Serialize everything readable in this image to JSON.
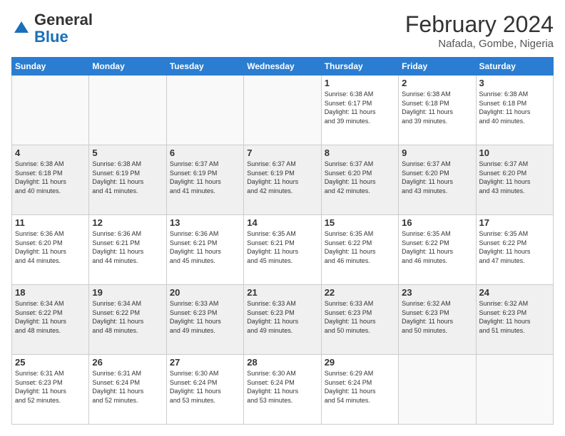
{
  "header": {
    "logo_general": "General",
    "logo_blue": "Blue",
    "title": "February 2024",
    "subtitle": "Nafada, Gombe, Nigeria"
  },
  "days_of_week": [
    "Sunday",
    "Monday",
    "Tuesday",
    "Wednesday",
    "Thursday",
    "Friday",
    "Saturday"
  ],
  "weeks": [
    [
      {
        "num": "",
        "info": ""
      },
      {
        "num": "",
        "info": ""
      },
      {
        "num": "",
        "info": ""
      },
      {
        "num": "",
        "info": ""
      },
      {
        "num": "1",
        "info": "Sunrise: 6:38 AM\nSunset: 6:17 PM\nDaylight: 11 hours\nand 39 minutes."
      },
      {
        "num": "2",
        "info": "Sunrise: 6:38 AM\nSunset: 6:18 PM\nDaylight: 11 hours\nand 39 minutes."
      },
      {
        "num": "3",
        "info": "Sunrise: 6:38 AM\nSunset: 6:18 PM\nDaylight: 11 hours\nand 40 minutes."
      }
    ],
    [
      {
        "num": "4",
        "info": "Sunrise: 6:38 AM\nSunset: 6:18 PM\nDaylight: 11 hours\nand 40 minutes."
      },
      {
        "num": "5",
        "info": "Sunrise: 6:38 AM\nSunset: 6:19 PM\nDaylight: 11 hours\nand 41 minutes."
      },
      {
        "num": "6",
        "info": "Sunrise: 6:37 AM\nSunset: 6:19 PM\nDaylight: 11 hours\nand 41 minutes."
      },
      {
        "num": "7",
        "info": "Sunrise: 6:37 AM\nSunset: 6:19 PM\nDaylight: 11 hours\nand 42 minutes."
      },
      {
        "num": "8",
        "info": "Sunrise: 6:37 AM\nSunset: 6:20 PM\nDaylight: 11 hours\nand 42 minutes."
      },
      {
        "num": "9",
        "info": "Sunrise: 6:37 AM\nSunset: 6:20 PM\nDaylight: 11 hours\nand 43 minutes."
      },
      {
        "num": "10",
        "info": "Sunrise: 6:37 AM\nSunset: 6:20 PM\nDaylight: 11 hours\nand 43 minutes."
      }
    ],
    [
      {
        "num": "11",
        "info": "Sunrise: 6:36 AM\nSunset: 6:20 PM\nDaylight: 11 hours\nand 44 minutes."
      },
      {
        "num": "12",
        "info": "Sunrise: 6:36 AM\nSunset: 6:21 PM\nDaylight: 11 hours\nand 44 minutes."
      },
      {
        "num": "13",
        "info": "Sunrise: 6:36 AM\nSunset: 6:21 PM\nDaylight: 11 hours\nand 45 minutes."
      },
      {
        "num": "14",
        "info": "Sunrise: 6:35 AM\nSunset: 6:21 PM\nDaylight: 11 hours\nand 45 minutes."
      },
      {
        "num": "15",
        "info": "Sunrise: 6:35 AM\nSunset: 6:22 PM\nDaylight: 11 hours\nand 46 minutes."
      },
      {
        "num": "16",
        "info": "Sunrise: 6:35 AM\nSunset: 6:22 PM\nDaylight: 11 hours\nand 46 minutes."
      },
      {
        "num": "17",
        "info": "Sunrise: 6:35 AM\nSunset: 6:22 PM\nDaylight: 11 hours\nand 47 minutes."
      }
    ],
    [
      {
        "num": "18",
        "info": "Sunrise: 6:34 AM\nSunset: 6:22 PM\nDaylight: 11 hours\nand 48 minutes."
      },
      {
        "num": "19",
        "info": "Sunrise: 6:34 AM\nSunset: 6:22 PM\nDaylight: 11 hours\nand 48 minutes."
      },
      {
        "num": "20",
        "info": "Sunrise: 6:33 AM\nSunset: 6:23 PM\nDaylight: 11 hours\nand 49 minutes."
      },
      {
        "num": "21",
        "info": "Sunrise: 6:33 AM\nSunset: 6:23 PM\nDaylight: 11 hours\nand 49 minutes."
      },
      {
        "num": "22",
        "info": "Sunrise: 6:33 AM\nSunset: 6:23 PM\nDaylight: 11 hours\nand 50 minutes."
      },
      {
        "num": "23",
        "info": "Sunrise: 6:32 AM\nSunset: 6:23 PM\nDaylight: 11 hours\nand 50 minutes."
      },
      {
        "num": "24",
        "info": "Sunrise: 6:32 AM\nSunset: 6:23 PM\nDaylight: 11 hours\nand 51 minutes."
      }
    ],
    [
      {
        "num": "25",
        "info": "Sunrise: 6:31 AM\nSunset: 6:23 PM\nDaylight: 11 hours\nand 52 minutes."
      },
      {
        "num": "26",
        "info": "Sunrise: 6:31 AM\nSunset: 6:24 PM\nDaylight: 11 hours\nand 52 minutes."
      },
      {
        "num": "27",
        "info": "Sunrise: 6:30 AM\nSunset: 6:24 PM\nDaylight: 11 hours\nand 53 minutes."
      },
      {
        "num": "28",
        "info": "Sunrise: 6:30 AM\nSunset: 6:24 PM\nDaylight: 11 hours\nand 53 minutes."
      },
      {
        "num": "29",
        "info": "Sunrise: 6:29 AM\nSunset: 6:24 PM\nDaylight: 11 hours\nand 54 minutes."
      },
      {
        "num": "",
        "info": ""
      },
      {
        "num": "",
        "info": ""
      }
    ]
  ]
}
